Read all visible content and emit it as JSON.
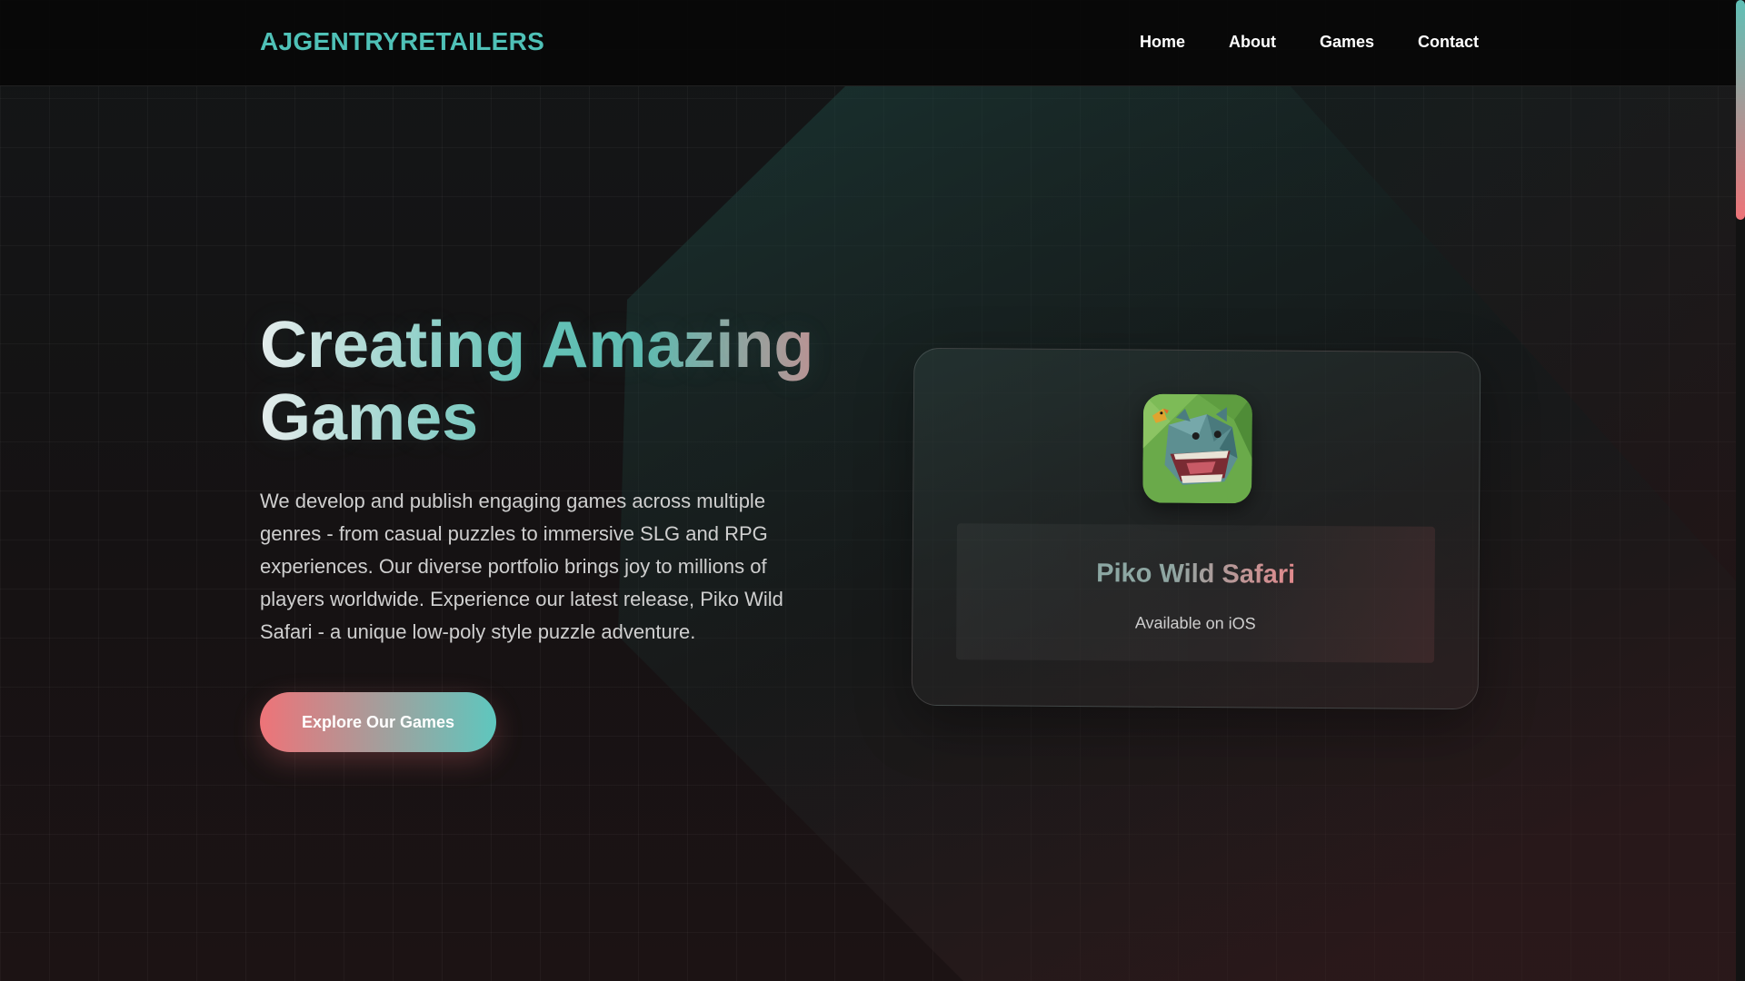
{
  "header": {
    "brand": "AJGENTRYRETAILERS",
    "nav": [
      "Home",
      "About",
      "Games",
      "Contact"
    ]
  },
  "hero": {
    "title": "Creating Amazing Games",
    "description": "We develop and publish engaging games across multiple genres - from casual puzzles to immersive SLG and RPG experiences. Our diverse portfolio brings joy to millions of players worldwide. Experience our latest release, Piko Wild Safari - a unique low-poly style puzzle adventure.",
    "cta_label": "Explore Our Games"
  },
  "featured_game": {
    "name": "Piko Wild Safari",
    "platform": "Available on iOS",
    "icon": "hippo-game-icon"
  },
  "colors": {
    "teal": "#4fc1b7",
    "coral": "#ee7378",
    "background": "#131314"
  }
}
